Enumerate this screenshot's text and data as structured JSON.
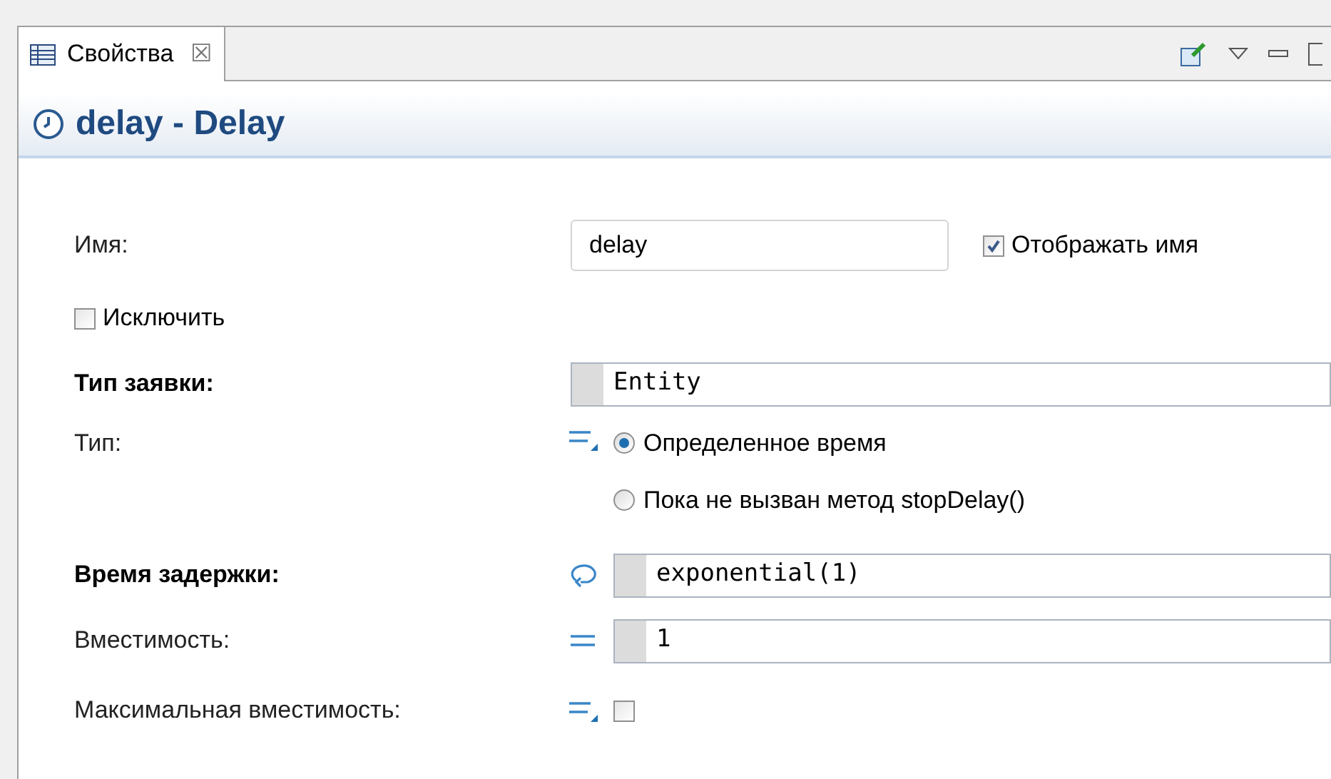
{
  "tab": {
    "label": "Свойства",
    "close": "☒"
  },
  "header": {
    "title": "delay - Delay"
  },
  "rows": [
    {
      "kind": "name",
      "label": "Имя:",
      "required": false,
      "value": "delay",
      "option": {
        "label": "Отображать имя",
        "checked": true
      }
    },
    {
      "kind": "checkbox",
      "label": "Исключить",
      "checked": false
    },
    {
      "kind": "code",
      "label": "Тип заявки:",
      "required": true,
      "value": "Entity"
    },
    {
      "kind": "radio",
      "label": "Тип:",
      "required": false,
      "options": [
        {
          "label": "Определенное время",
          "selected": true
        },
        {
          "label": "Пока не вызван метод stopDelay()",
          "selected": false
        }
      ]
    },
    {
      "kind": "code",
      "label": "Время задержки:",
      "required": true,
      "dynamic": true,
      "value": "exponential(1)"
    },
    {
      "kind": "code",
      "label": "Вместимость:",
      "required": false,
      "dynamic": false,
      "value": "1"
    },
    {
      "kind": "flag",
      "label": "Максимальная вместимость:",
      "required": false,
      "checked": false
    }
  ]
}
